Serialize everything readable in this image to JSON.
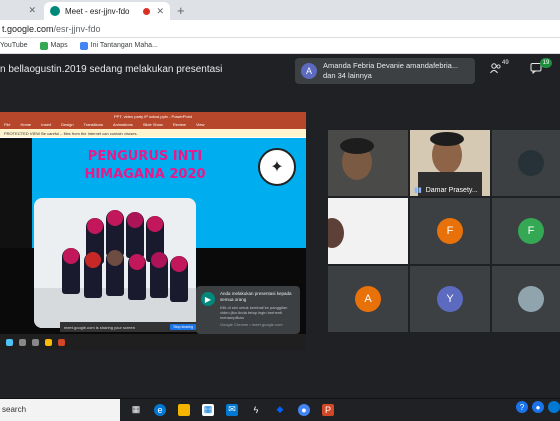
{
  "browser": {
    "prev_tab_close": "✕",
    "active_tab_title": "Meet - esr-jjnv-fdo",
    "active_tab_close": "✕",
    "new_tab": "+",
    "address_host": "t.google.com",
    "address_path": "/esr-jjnv-fdo",
    "bookmarks": [
      {
        "label": "YouTube",
        "color": "#ff0000"
      },
      {
        "label": "Maps",
        "color": "#34a853"
      },
      {
        "label": "Ini Tantangan Maha...",
        "color": "#4285f4"
      }
    ]
  },
  "meet": {
    "presenter_title": "n bellaogustin.2019 sedang melakukan presentasi",
    "attendee_avatar": "A",
    "attendee_line1": "Amanda Febria Devanie amandafebria...",
    "attendee_line2": "dan 34 lainnya",
    "people_count": "49",
    "chat_badge": "19",
    "participant_name": "Damar Prasety...",
    "tiles": [
      {
        "letter": "F",
        "color": "#e8710a"
      },
      {
        "letter": "F",
        "color": "#34a853"
      },
      {
        "letter": "A",
        "color": "#e8710a"
      },
      {
        "letter": "Y",
        "color": "#5c6bc0"
      }
    ]
  },
  "presentation": {
    "window_title": "PPT. video party IP solusi.pptx - PowerPoint",
    "ribbon": [
      "File",
      "Home",
      "Insert",
      "Design",
      "Transitions",
      "Animations",
      "Slide Show",
      "Review",
      "View"
    ],
    "warning": "PROTECTED VIEW  Be careful – files from the Internet can contain viruses.",
    "slide_title_line1": "PENGURUS INTI",
    "slide_title_line2": "HIMAGANA 2020",
    "share_bar_text": "meet.google.com is sharing your screen",
    "share_bar_stop": "Stop sharing"
  },
  "toast": {
    "title": "Anda melakukan presentasi kepada semua orang",
    "body": "Klik di sini untuk kembali ke panggilan video jika Anda tetap ingin berhenti menampilkan",
    "source": "Google Chrome • meet.google.com"
  },
  "taskbar": {
    "search_placeholder": "search",
    "help_icon": "?"
  }
}
